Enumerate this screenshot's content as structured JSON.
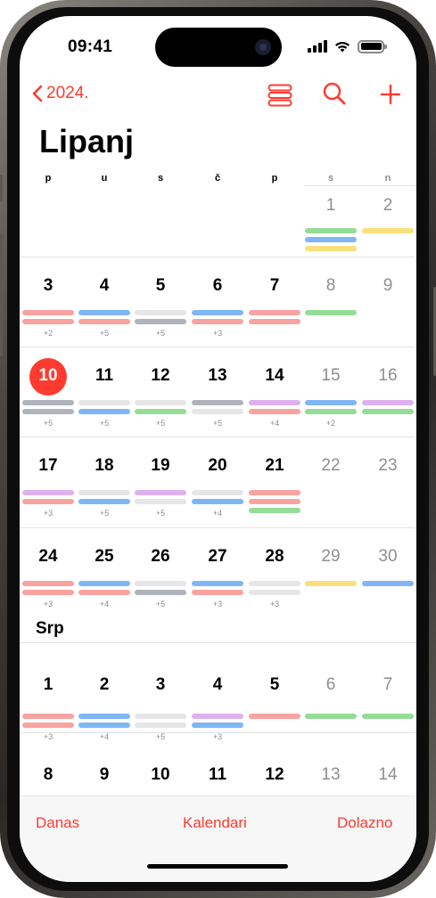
{
  "status": {
    "time": "09:41"
  },
  "nav": {
    "back_label": "2024."
  },
  "month": {
    "title": "Lipanj",
    "next_title": "Srp"
  },
  "weekdays": [
    "p",
    "u",
    "s",
    "č",
    "p",
    "s",
    "n"
  ],
  "today": "10",
  "colors": {
    "accent": "#ff3b30",
    "red": "#f8a3a0",
    "blue": "#7fb6f4",
    "gray": "#aeb3bc",
    "light": "#e6e6e8",
    "green": "#95dc97",
    "yellow": "#f9e07a",
    "purple": "#deb1ee"
  },
  "weeks": [
    {
      "days": [
        null,
        null,
        null,
        null,
        null,
        "1",
        "2"
      ],
      "bars": [
        [],
        [],
        [],
        [],
        [],
        [
          "green",
          "blue",
          "yellow"
        ],
        [
          "yellow"
        ]
      ],
      "more": [
        null,
        null,
        null,
        null,
        null,
        null,
        null
      ]
    },
    {
      "days": [
        "3",
        "4",
        "5",
        "6",
        "7",
        "8",
        "9"
      ],
      "bars": [
        [
          "red",
          "red"
        ],
        [
          "blue",
          "red"
        ],
        [
          "light",
          "gray"
        ],
        [
          "blue",
          "red"
        ],
        [
          "red",
          "red"
        ],
        [
          "green"
        ],
        []
      ],
      "more": [
        "+2",
        "+5",
        "+5",
        "+3",
        null,
        null,
        null
      ]
    },
    {
      "days": [
        "10",
        "11",
        "12",
        "13",
        "14",
        "15",
        "16"
      ],
      "bars": [
        [
          "gray",
          "gray"
        ],
        [
          "light",
          "blue"
        ],
        [
          "light",
          "green"
        ],
        [
          "gray",
          "light"
        ],
        [
          "purple",
          "red"
        ],
        [
          "blue",
          "green"
        ],
        [
          "purple",
          "green"
        ]
      ],
      "more": [
        "+5",
        "+5",
        "+5",
        "+5",
        "+4",
        "+2",
        null
      ]
    },
    {
      "days": [
        "17",
        "18",
        "19",
        "20",
        "21",
        "22",
        "23"
      ],
      "bars": [
        [
          "purple",
          "red"
        ],
        [
          "light",
          "blue"
        ],
        [
          "purple",
          "light"
        ],
        [
          "light",
          "blue"
        ],
        [
          "red",
          "red",
          "green"
        ],
        [],
        []
      ],
      "more": [
        "+3",
        "+5",
        "+5",
        "+4",
        null,
        null,
        null
      ]
    },
    {
      "days": [
        "24",
        "25",
        "26",
        "27",
        "28",
        "29",
        "30"
      ],
      "bars": [
        [
          "red",
          "red"
        ],
        [
          "blue",
          "red"
        ],
        [
          "light",
          "gray"
        ],
        [
          "blue",
          "red"
        ],
        [
          "light",
          "light"
        ],
        [
          "yellow"
        ],
        [
          "blue"
        ]
      ],
      "more": [
        "+3",
        "+4",
        "+5",
        "+3",
        "+3",
        null,
        null
      ]
    },
    {
      "days": [
        "1",
        "2",
        "3",
        "4",
        "5",
        "6",
        "7"
      ],
      "bars": [
        [
          "red",
          "red"
        ],
        [
          "blue",
          "blue"
        ],
        [
          "light",
          "light"
        ],
        [
          "purple",
          "blue"
        ],
        [
          "red"
        ],
        [
          "green"
        ],
        [
          "green"
        ]
      ],
      "more": [
        "+3",
        "+4",
        "+5",
        "+3",
        null,
        null,
        null
      ]
    },
    {
      "days": [
        "8",
        "9",
        "10",
        "11",
        "12",
        "13",
        "14"
      ],
      "bars": [
        [
          "red"
        ],
        [
          "blue"
        ],
        [
          "light"
        ],
        [
          "purple"
        ],
        [
          "red"
        ],
        [
          "green"
        ],
        [
          "green"
        ]
      ],
      "more": [
        null,
        null,
        null,
        null,
        null,
        null,
        null
      ]
    }
  ],
  "tabs": {
    "today": "Danas",
    "calendars": "Kalendari",
    "inbox": "Dolazno"
  }
}
